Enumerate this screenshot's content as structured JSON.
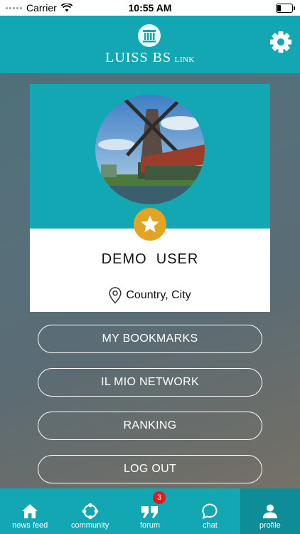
{
  "status_bar": {
    "carrier": "Carrier",
    "time": "10:55 AM",
    "battery_level": 0.25
  },
  "header": {
    "logo_main": "LUISS BS",
    "logo_sub": "LINK",
    "settings_icon": "gear-icon"
  },
  "profile": {
    "name": "DEMO  USER",
    "location": "Country, City",
    "badge_icon": "star-icon",
    "location_icon": "map-pin-icon"
  },
  "menu": {
    "items": [
      {
        "label": "MY BOOKMARKS"
      },
      {
        "label": "IL MIO NETWORK"
      },
      {
        "label": "RANKING"
      },
      {
        "label": "LOG OUT"
      }
    ]
  },
  "tabs": [
    {
      "label": "news feed",
      "icon": "home-icon"
    },
    {
      "label": "community",
      "icon": "community-icon"
    },
    {
      "label": "forum",
      "icon": "quote-icon",
      "badge": "3"
    },
    {
      "label": "chat",
      "icon": "chat-bubble-icon"
    },
    {
      "label": "profile",
      "icon": "user-icon",
      "active": true
    }
  ],
  "colors": {
    "brand": "#13a7b3",
    "brand_dark": "#0e8c98",
    "badge_gold": "#e2a422",
    "notification_red": "#e01b1b"
  }
}
